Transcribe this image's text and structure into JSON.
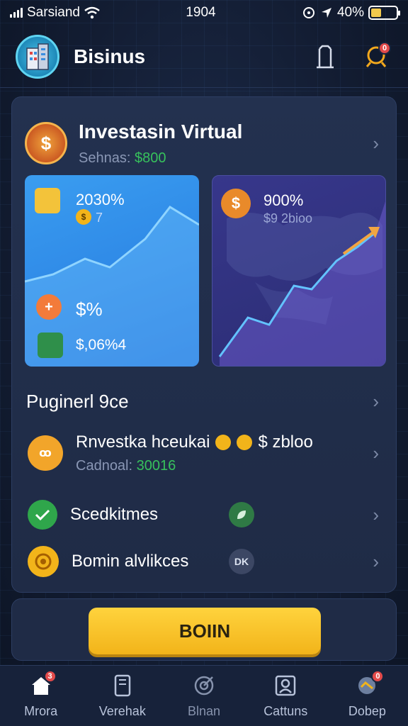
{
  "status_bar": {
    "carrier": "Sarsiand",
    "time": "1904",
    "battery": "40%",
    "battery_level": 0.4
  },
  "header": {
    "title": "Bisinus"
  },
  "investment": {
    "title": "Investasin Virtual",
    "subtitle_label": "Sehnas:",
    "subtitle_value": "$800"
  },
  "tiles": {
    "left": {
      "percent": "2030%",
      "small": "7",
      "mid_value": "$%",
      "bottom_value": "$,06%4"
    },
    "right": {
      "percent": "900%",
      "small": "$9 2bioo"
    }
  },
  "section": {
    "title": "Puginerl 9ce"
  },
  "list": [
    {
      "label": "Rnvestka hceukai",
      "suffix": "$ zbloo",
      "sub_label": "Cadnoal:",
      "sub_value": "30016"
    },
    {
      "label": "Scedkitmes"
    },
    {
      "label": "Bomin alvlikces",
      "pill": "DK"
    }
  ],
  "cta": {
    "label": "BOIIN"
  },
  "tabs": [
    {
      "label": "Mrora",
      "badge": "3"
    },
    {
      "label": "Verehak"
    },
    {
      "label": "Blnan"
    },
    {
      "label": "Cattuns"
    },
    {
      "label": "Dobep",
      "badge": "0"
    }
  ],
  "header_badge": "0",
  "colors": {
    "accent_yellow": "#f2b41a",
    "tile_blue": "#2476de",
    "tile_purple": "#2b2d74",
    "green": "#37c15c"
  }
}
